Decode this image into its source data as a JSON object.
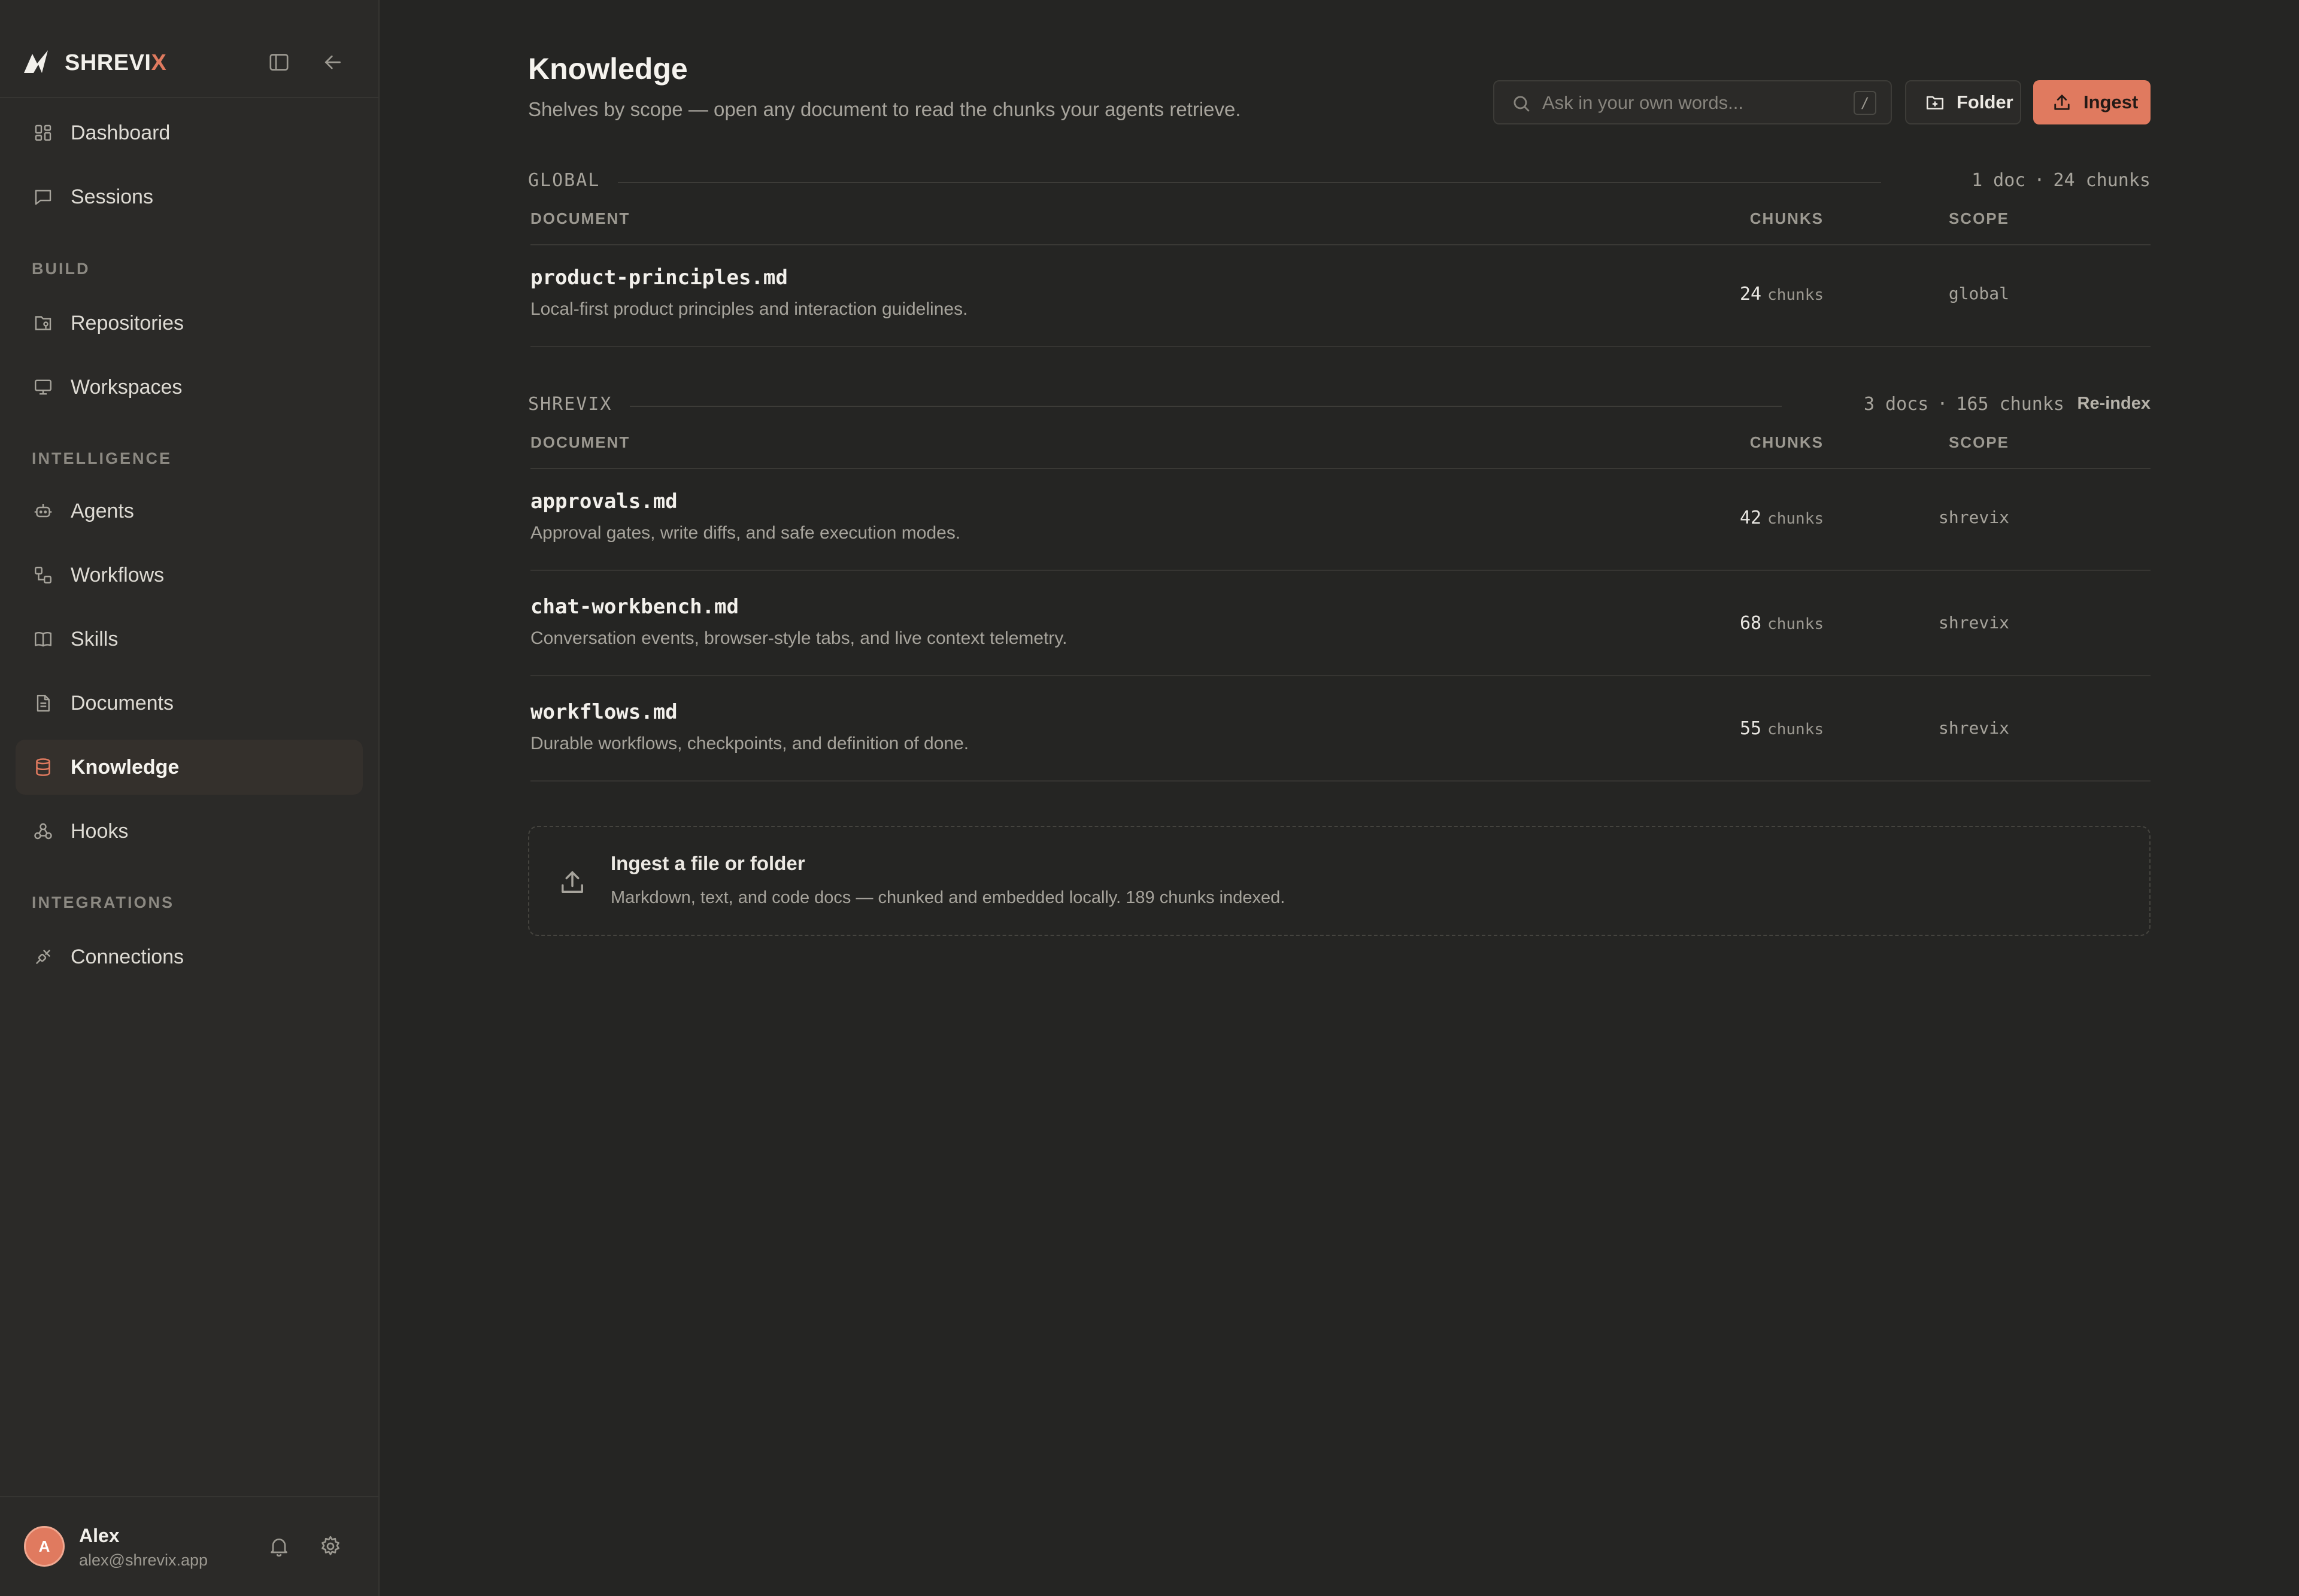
{
  "brand": {
    "name_main": "SHREVI",
    "name_accent": "X",
    "accent_color": "#e07a5f"
  },
  "nav": {
    "top": [
      {
        "label": "Dashboard",
        "icon": "dashboard-icon"
      },
      {
        "label": "Sessions",
        "icon": "chat-bubble-icon"
      }
    ],
    "build_label": "BUILD",
    "build": [
      {
        "label": "Repositories",
        "icon": "repository-icon"
      },
      {
        "label": "Workspaces",
        "icon": "monitor-icon"
      }
    ],
    "intelligence_label": "INTELLIGENCE",
    "intelligence": [
      {
        "label": "Agents",
        "icon": "robot-icon"
      },
      {
        "label": "Workflows",
        "icon": "workflow-icon"
      },
      {
        "label": "Skills",
        "icon": "book-icon"
      },
      {
        "label": "Documents",
        "icon": "document-icon"
      },
      {
        "label": "Knowledge",
        "icon": "database-icon",
        "active": true
      },
      {
        "label": "Hooks",
        "icon": "webhook-icon"
      }
    ],
    "integrations_label": "INTEGRATIONS",
    "integrations": [
      {
        "label": "Connections",
        "icon": "plug-icon"
      }
    ]
  },
  "user": {
    "initial": "A",
    "name": "Alex",
    "email": "alex@shrevix.app"
  },
  "page": {
    "title": "Knowledge",
    "subtitle": "Shelves by scope — open any document to read the chunks your agents retrieve."
  },
  "search": {
    "placeholder": "Ask in your own words...",
    "shortcut": "/"
  },
  "buttons": {
    "folder": "Folder",
    "ingest": "Ingest"
  },
  "columns": {
    "document": "DOCUMENT",
    "chunks": "CHUNKS",
    "scope": "SCOPE"
  },
  "groups": [
    {
      "name": "GLOBAL",
      "docs_count": "1 doc",
      "chunks_count": "24 chunks",
      "rows": [
        {
          "name": "product-principles.md",
          "desc": "Local-first product principles and interaction guidelines.",
          "chunks": "24",
          "unit": "chunks",
          "scope": "global"
        }
      ]
    },
    {
      "name": "SHREVIX",
      "docs_count": "3 docs",
      "chunks_count": "165 chunks",
      "action": "Re-index",
      "rows": [
        {
          "name": "approvals.md",
          "desc": "Approval gates, write diffs, and safe execution modes.",
          "chunks": "42",
          "unit": "chunks",
          "scope": "shrevix"
        },
        {
          "name": "chat-workbench.md",
          "desc": "Conversation events, browser-style tabs, and live context telemetry.",
          "chunks": "68",
          "unit": "chunks",
          "scope": "shrevix"
        },
        {
          "name": "workflows.md",
          "desc": "Durable workflows, checkpoints, and definition of done.",
          "chunks": "55",
          "unit": "chunks",
          "scope": "shrevix"
        }
      ]
    }
  ],
  "dropzone": {
    "title": "Ingest a file or folder",
    "subtitle": "Markdown, text, and code docs — chunked and embedded locally. 189 chunks indexed."
  },
  "separator": "·"
}
